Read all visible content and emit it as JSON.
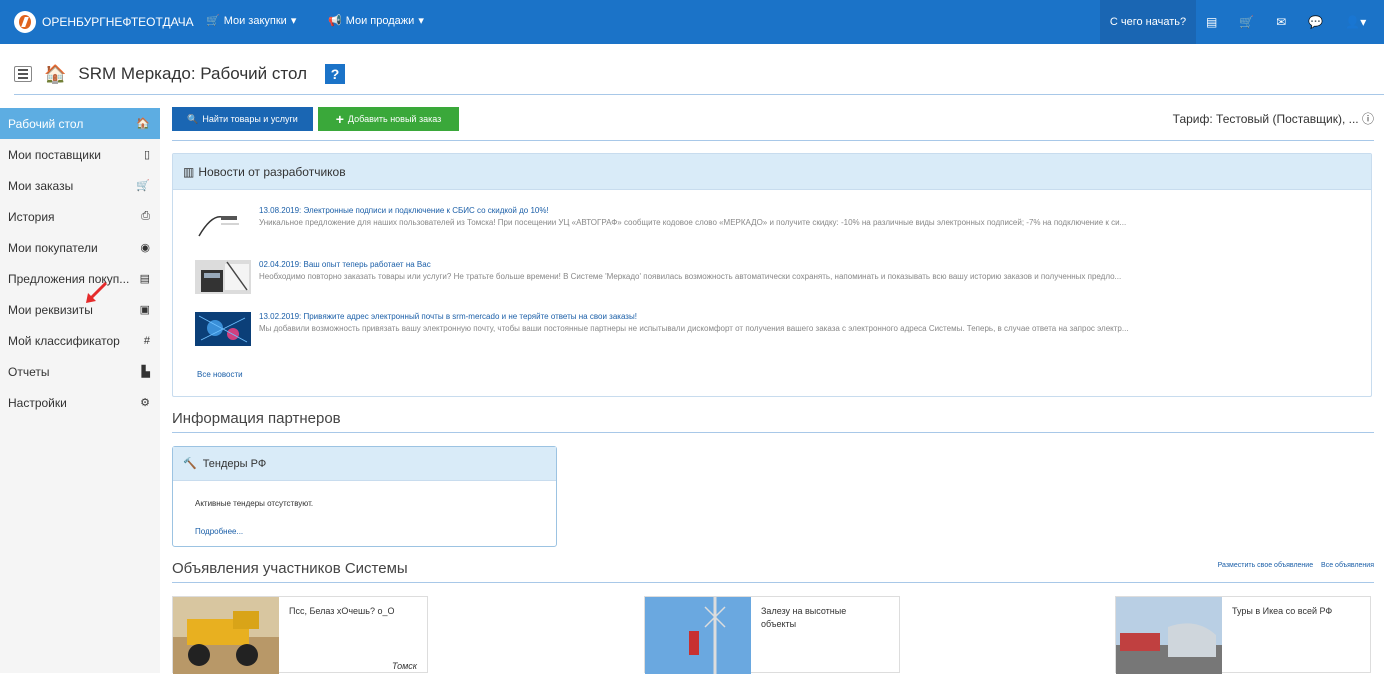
{
  "navbar": {
    "brand": "ОРЕНБУРГНЕФТЕОТДАЧА",
    "menus": [
      {
        "label": "Мои закупки",
        "icon": "cart-icon"
      },
      {
        "label": "Мои продажи",
        "icon": "megaphone-icon"
      }
    ],
    "start_label": "С чего начать?",
    "icons": [
      "list-icon",
      "cart-icon",
      "envelope-icon",
      "chat-icon",
      "user-icon"
    ]
  },
  "header": {
    "title": "SRM Меркадо: Рабочий стол",
    "help": "?"
  },
  "sidebar": {
    "items": [
      {
        "label": "Рабочий стол",
        "icon": "home-icon",
        "glyph": "🏠"
      },
      {
        "label": "Мои поставщики",
        "icon": "document-icon",
        "glyph": "▯"
      },
      {
        "label": "Мои заказы",
        "icon": "cart-icon",
        "glyph": "🛒"
      },
      {
        "label": "История",
        "icon": "print-icon",
        "glyph": "⎙"
      },
      {
        "label": "Мои покупатели",
        "icon": "eye-icon",
        "glyph": "◉"
      },
      {
        "label": "Предложения покуп...",
        "icon": "file-icon",
        "glyph": "▤"
      },
      {
        "label": "Мои реквизиты",
        "icon": "id-card-icon",
        "glyph": "▣"
      },
      {
        "label": "Мой классификатор",
        "icon": "hash-icon",
        "glyph": "#"
      },
      {
        "label": "Отчеты",
        "icon": "report-icon",
        "glyph": "▙"
      },
      {
        "label": "Настройки",
        "icon": "gears-icon",
        "glyph": "⚙"
      }
    ]
  },
  "toolbar": {
    "find_label": "Найти товары и услуги",
    "add_label": "Добавить новый заказ",
    "tariff": "Тариф: Тестовый (Поставщик), ..."
  },
  "news": {
    "heading": "Новости от разработчиков",
    "items": [
      {
        "title": "13.08.2019: Электронные подписи и подключение к СБИС со скидкой до 10%!",
        "desc": "Уникальное предложение для наших пользователей из Томска! При посещении УЦ «АВТОГРАФ» сообщите кодовое слово «МЕРКАДО» и получите скидку: -10% на различные виды электронных подписей; -7% на подключение к си..."
      },
      {
        "title": "02.04.2019: Ваш опыт теперь работает на Вас",
        "desc": "Необходимо повторно заказать товары или услуги? Не тратьте больше времени! В Системе 'Меркадо' появилась возможность автоматически сохранять, напоминать и показывать всю вашу историю заказов и полученных предло..."
      },
      {
        "title": "13.02.2019: Привяжите адрес электронный почты в srm-mercado и не теряйте ответы на свои заказы!",
        "desc": "Мы добавили возможность привязать вашу электронную почту, чтобы ваши постоянные партнеры не испытывали дискомфорт от получения вашего заказа с электронного адреса Системы. Теперь, в случае ответа на запрос электр..."
      }
    ],
    "all_link": "Все новости"
  },
  "partners": {
    "heading": "Информация партнеров",
    "tender_title": "Тендеры РФ",
    "tender_text": "Активные тендеры отсутствуют.",
    "tender_link": "Подробнее..."
  },
  "ads": {
    "heading": "Объявления участников Системы",
    "post_link": "Разместить свое объявление",
    "all_link": "Все объявления",
    "items": [
      {
        "title": "Псс, Белаз хОчешь? о_О",
        "city": "Томск"
      },
      {
        "title": "Залезу на высотные объекты",
        "city": ""
      },
      {
        "title": "Туры в Икеа со всей РФ",
        "city": ""
      }
    ]
  }
}
